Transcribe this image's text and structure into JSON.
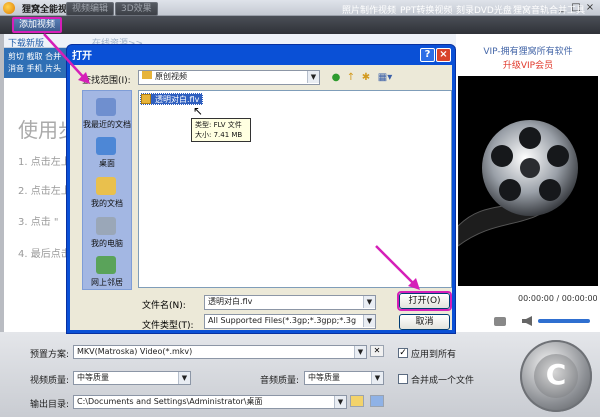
{
  "app": {
    "title": "狸窝全能视频转换器",
    "window_controls": [
      "_",
      "□",
      "×"
    ]
  },
  "toolbar": {
    "add_video": "添加视频",
    "video_edit": "视频编辑",
    "effect_3d": "3D效果",
    "links": [
      "照片制作视频",
      "PPT转换视频",
      "刻录DVD光盘",
      "狸窝音轨合并工具"
    ]
  },
  "tabs": {
    "download": "下载新版",
    "online": "在线资源>>"
  },
  "quick": {
    "line1": "剪切  截取  合并",
    "line2": "消音  手机  片头"
  },
  "guide": {
    "title": "使用步",
    "steps": [
      "1. 点击左上",
      "2. 点击左上",
      "3. 点击 \"",
      "4. 最后点击"
    ]
  },
  "vip": {
    "line1": "VIP-拥有狸窝所有软件",
    "line2": "升级VIP会员"
  },
  "player": {
    "time": "00:00:00 / 00:00:00"
  },
  "bottom": {
    "preset_label": "预置方案:",
    "preset_value": "MKV(Matroska) Video(*.mkv)",
    "apply_all": "应用到所有",
    "video_quality_label": "视频质量:",
    "video_quality_value": "中等质量",
    "audio_quality_label": "音频质量:",
    "audio_quality_value": "中等质量",
    "merge_label": "合并成一个文件",
    "output_label": "输出目录:",
    "output_path": "C:\\Documents and Settings\\Administrator\\桌面"
  },
  "dialog": {
    "title": "打开",
    "look_in_label": "查找范围(I):",
    "look_in_value": "原创视频",
    "places": [
      "我最近的文档",
      "桌面",
      "我的文档",
      "我的电脑",
      "网上邻居"
    ],
    "file_name": "透明对白.flv",
    "tooltip_line1": "类型: FLV 文件",
    "tooltip_line2": "大小: 7.41 MB",
    "file_name_label": "文件名(N):",
    "file_name_value": "透明对白.flv",
    "file_type_label": "文件类型(T):",
    "file_type_value": "All Supported Files(*.3gp;*.3gpp;*.3g",
    "open_button": "打开(O)",
    "cancel_button": "取消",
    "help": "?",
    "close": "×"
  },
  "colors": {
    "highlight": "#d51fb8",
    "dialog_title": "#0a50d6",
    "vip_red": "#e0392b"
  }
}
